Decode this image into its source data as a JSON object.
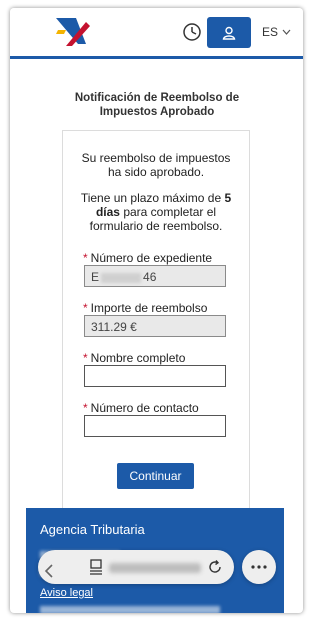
{
  "header": {
    "language": "ES"
  },
  "page": {
    "title_line1": "Notificación de Reembolso de",
    "title_line2": "Impuestos Aprobado"
  },
  "message": {
    "line1": "Su reembolso de impuestos",
    "line2": "ha sido aprobado.",
    "deadline_prefix": "Tiene un plazo máximo de ",
    "deadline_bold_num": "5",
    "deadline_bold_word": "días",
    "deadline_suffix": " para completar el",
    "line_form": "formulario de reembolso."
  },
  "form": {
    "fields": [
      {
        "label": "Número de expediente",
        "value_start": "E",
        "value_end": "46",
        "readonly": true
      },
      {
        "label": "Importe de reembolso",
        "value": "311.29 €",
        "readonly": true
      },
      {
        "label": "Nombre completo",
        "value": "",
        "readonly": false
      },
      {
        "label": "Número de contacto",
        "value": "",
        "readonly": false
      }
    ],
    "submit_label": "Continuar"
  },
  "footer": {
    "title": "Agencia Tributaria",
    "link_aviso": "Aviso legal"
  },
  "colors": {
    "primary": "#1c5aa8",
    "required": "#c4122f"
  },
  "icons": {
    "logo": "agencia-tributaria-logo",
    "clock": "clock-icon",
    "user": "user-icon",
    "chevron": "chevron-down-icon",
    "back": "back-arrow-icon",
    "tabs": "tabs-icon",
    "reload": "reload-icon",
    "more": "more-icon"
  }
}
